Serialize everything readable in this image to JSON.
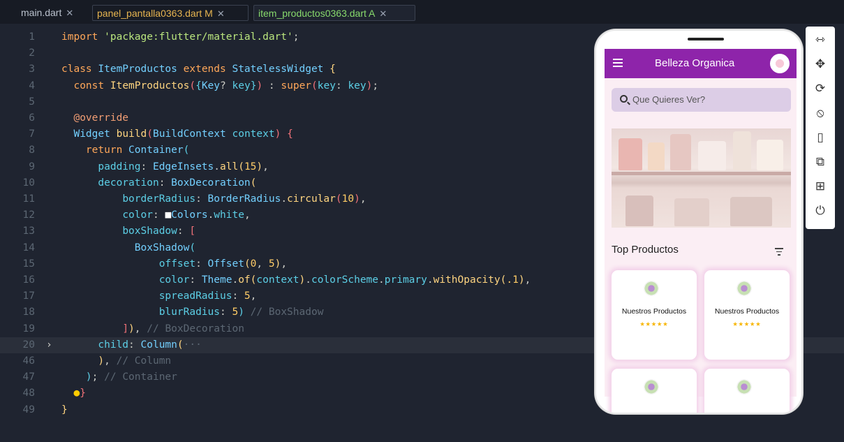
{
  "tabs": [
    {
      "label": "main.dart",
      "status": ""
    },
    {
      "label": "panel_pantalla0363.dart",
      "status": "M"
    },
    {
      "label": "item_productos0363.dart",
      "status": "A"
    }
  ],
  "code_lines": [
    {
      "n": "1",
      "html": "<span class='kw'>import</span> <span class='str'>'package:flutter/material.dart'</span>;"
    },
    {
      "n": "2",
      "html": ""
    },
    {
      "n": "3",
      "html": "<span class='kw'>class</span> <span class='cls'>ItemProductos</span> <span class='kw'>extends</span> <span class='cls'>StatelessWidget</span> <span class='br'>{</span>"
    },
    {
      "n": "4",
      "html": "  <span class='kw'>const</span> <span class='fn'>ItemProductos</span><span class='br2'>(</span><span class='br3'>{</span><span class='cls'>Key</span>? <span class='prop'>key</span><span class='br3'>}</span><span class='br2'>)</span> : <span class='kw'>super</span><span class='br2'>(</span><span class='prop'>key</span>: <span class='prop'>key</span><span class='br2'>)</span>;"
    },
    {
      "n": "5",
      "html": ""
    },
    {
      "n": "6",
      "html": "  <span class='dec'>@override</span>"
    },
    {
      "n": "7",
      "html": "  <span class='cls'>Widget</span> <span class='fn'>build</span><span class='br2'>(</span><span class='cls'>BuildContext</span> <span class='prop'>context</span><span class='br2'>)</span> <span class='br2'>{</span>"
    },
    {
      "n": "8",
      "html": "    <span class='kw'>return</span> <span class='cls'>Container</span><span class='br3'>(</span>"
    },
    {
      "n": "9",
      "html": "      <span class='prop'>padding</span>: <span class='cls'>EdgeInsets</span>.<span class='fn'>all</span><span class='br'>(</span><span class='num'>15</span><span class='br'>)</span>,"
    },
    {
      "n": "10",
      "html": "      <span class='prop'>decoration</span>: <span class='cls'>BoxDecoration</span><span class='br'>(</span>"
    },
    {
      "n": "11",
      "html": "          <span class='prop'>borderRadius</span>: <span class='cls'>BorderRadius</span>.<span class='fn'>circular</span><span class='br2'>(</span><span class='num'>10</span><span class='br2'>)</span>,"
    },
    {
      "n": "12",
      "html": "          <span class='prop'>color</span>: <span style='color:#fff'>&#9632;</span><span class='cls'>Colors</span>.<span class='prop'>white</span>,"
    },
    {
      "n": "13",
      "html": "          <span class='prop'>boxShadow</span>: <span class='br2'>[</span>"
    },
    {
      "n": "14",
      "html": "            <span class='cls'>BoxShadow</span><span class='br3'>(</span>"
    },
    {
      "n": "15",
      "html": "                <span class='prop'>offset</span>: <span class='cls'>Offset</span><span class='br'>(</span><span class='num'>0</span>, <span class='num'>5</span><span class='br'>)</span>,"
    },
    {
      "n": "16",
      "html": "                <span class='prop'>color</span>: <span class='cls'>Theme</span>.<span class='fn'>of</span><span class='br'>(</span><span class='prop'>context</span><span class='br'>)</span>.<span class='prop'>colorScheme</span>.<span class='prop'>primary</span>.<span class='fn'>withOpacity</span><span class='br'>(</span><span class='num'>.1</span><span class='br'>)</span>,"
    },
    {
      "n": "17",
      "html": "                <span class='prop'>spreadRadius</span>: <span class='num'>5</span>,"
    },
    {
      "n": "18",
      "html": "                <span class='prop'>blurRadius</span>: <span class='num'>5</span><span class='br3'>)</span> <span class='cm'>// BoxShadow</span>"
    },
    {
      "n": "19",
      "html": "          <span class='br2'>]</span><span class='br'>)</span>, <span class='cm'>// BoxDecoration</span>"
    },
    {
      "n": "20",
      "html": "      <span class='prop'>child</span>: <span class='cls'>Column</span><span class='br'>(</span><span class='cm'>···</span>"
    },
    {
      "n": "46",
      "html": "      <span class='br'>)</span>, <span class='cm'>// Column</span>"
    },
    {
      "n": "47",
      "html": "    <span class='br3'>)</span>; <span class='cm'>// Container</span>"
    },
    {
      "n": "48",
      "html": "  <span style='color:#ffcc00'>&#9679;</span><span class='br2'>}</span>"
    },
    {
      "n": "49",
      "html": "<span class='br'>}</span>"
    }
  ],
  "phone": {
    "app_title": "Belleza Organica",
    "search_placeholder": "Que Quieres Ver?",
    "section_title": "Top Productos",
    "cards": [
      {
        "name": "Nuestros Productos",
        "stars": "★★★★★"
      },
      {
        "name": "Nuestros Productos",
        "stars": "★★★★★"
      },
      {
        "name": "",
        "stars": ""
      },
      {
        "name": "",
        "stars": ""
      }
    ]
  },
  "toolbar": {
    "icons": [
      "resize-icon",
      "move-icon",
      "rotate-icon",
      "device-rotate-icon",
      "phone-icon",
      "open-external-icon",
      "qr-code-icon",
      "power-icon"
    ],
    "glyphs": [
      "⇿",
      "✥",
      "⟳",
      "⦸",
      "▯",
      "⧉",
      "⊞",
      "⏻"
    ]
  },
  "colors": {
    "appbar": "#8e24aa",
    "editor_bg": "#1f2430",
    "accent_modified": "#e6b450",
    "accent_added": "#87d96c"
  }
}
